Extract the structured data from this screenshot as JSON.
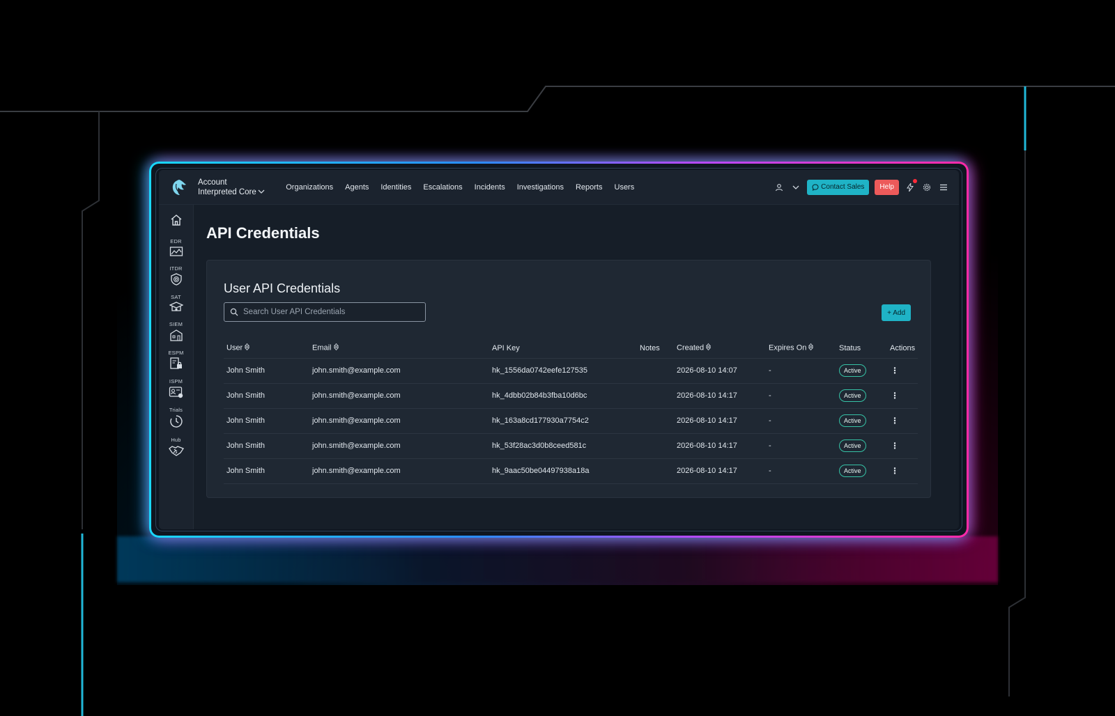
{
  "colors": {
    "accent": "#1fb3c6",
    "help": "#ec5a5a",
    "neon_left": "#19d8ff",
    "neon_right": "#ff2aa8",
    "status_active": "#36c3a6"
  },
  "header": {
    "account_label": "Account",
    "account_name": "Interpreted Core",
    "nav": [
      "Organizations",
      "Agents",
      "Identities",
      "Escalations",
      "Incidents",
      "Investigations",
      "Reports",
      "Users"
    ],
    "contact_sales": "Contact Sales",
    "help": "Help"
  },
  "sidebar": {
    "items": [
      {
        "label": "",
        "icon": "home-icon"
      },
      {
        "label": "EDR",
        "icon": "chart-icon"
      },
      {
        "label": "ITDR",
        "icon": "fingerprint-shield-icon"
      },
      {
        "label": "SAT",
        "icon": "graduation-icon"
      },
      {
        "label": "SIEM",
        "icon": "building-icon"
      },
      {
        "label": "ESPM",
        "icon": "lock-doc-icon"
      },
      {
        "label": "ISPM",
        "icon": "id-card-icon"
      },
      {
        "label": "Trials",
        "icon": "clock-icon"
      },
      {
        "label": "Hub",
        "icon": "handshake-icon"
      }
    ]
  },
  "page": {
    "title": "API Credentials",
    "card_title": "User API Credentials",
    "search_placeholder": "Search User API Credentials",
    "add_button": "+ Add"
  },
  "table": {
    "columns": [
      "User",
      "Email",
      "API Key",
      "Notes",
      "Created",
      "Expires On",
      "Status",
      "Actions"
    ],
    "rows": [
      {
        "user": "John Smith",
        "email": "john.smith@example.com",
        "api_key": "hk_1556da0742eefe127535",
        "notes": "",
        "created": "2026-08-10 14:07",
        "expires": "-",
        "status": "Active"
      },
      {
        "user": "John Smith",
        "email": "john.smith@example.com",
        "api_key": "hk_4dbb02b84b3fba10d6bc",
        "notes": "",
        "created": "2026-08-10 14:17",
        "expires": "-",
        "status": "Active"
      },
      {
        "user": "John Smith",
        "email": "john.smith@example.com",
        "api_key": "hk_163a8cd177930a7754c2",
        "notes": "",
        "created": "2026-08-10 14:17",
        "expires": "-",
        "status": "Active"
      },
      {
        "user": "John Smith",
        "email": "john.smith@example.com",
        "api_key": "hk_53f28ac3d0b8ceed581c",
        "notes": "",
        "created": "2026-08-10 14:17",
        "expires": "-",
        "status": "Active"
      },
      {
        "user": "John Smith",
        "email": "john.smith@example.com",
        "api_key": "hk_9aac50be04497938a18a",
        "notes": "",
        "created": "2026-08-10 14:17",
        "expires": "-",
        "status": "Active"
      }
    ]
  }
}
